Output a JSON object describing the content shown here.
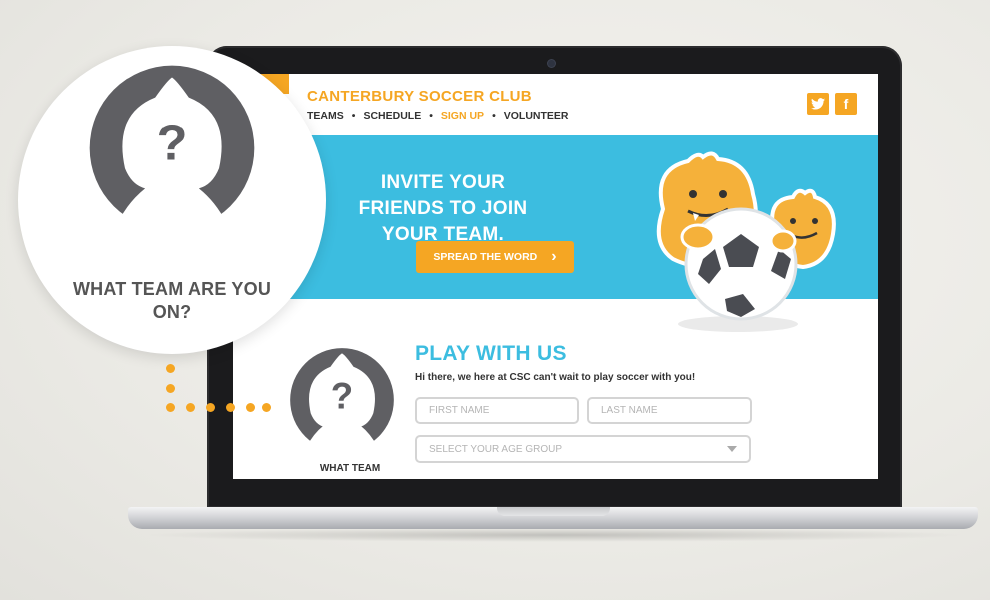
{
  "site": {
    "club_name": "CANTERBURY SOCCER CLUB",
    "nav": [
      {
        "label": "TEAMS"
      },
      {
        "label": "SCHEDULE"
      },
      {
        "label": "SIGN UP",
        "active": true
      },
      {
        "label": "VOLUNTEER"
      }
    ],
    "nav_separator": "•",
    "social": [
      {
        "icon": "twitter-icon",
        "glyph": "🐦"
      },
      {
        "icon": "facebook-icon",
        "glyph": "f"
      }
    ]
  },
  "banner": {
    "headline": "INVITE YOUR FRIENDS TO JOIN YOUR TEAM.",
    "cta_label": "SPREAD THE WORD",
    "cta_arrow": "›",
    "illustration": "mascots-with-soccer-ball"
  },
  "signup": {
    "title": "PLAY WITH US",
    "intro": "Hi there, we here at CSC can't wait to play soccer with you!",
    "first_name_placeholder": "FIRST NAME",
    "last_name_placeholder": "LAST NAME",
    "age_group_placeholder": "SELECT YOUR AGE GROUP",
    "team_avatar_label": "WHAT TEAM"
  },
  "callout": {
    "text": "WHAT TEAM ARE YOU ON?",
    "avatar_glyph": "?"
  },
  "colors": {
    "accent_orange": "#f5a623",
    "accent_blue": "#3cbde0",
    "avatar_gray": "#5f5f63"
  }
}
